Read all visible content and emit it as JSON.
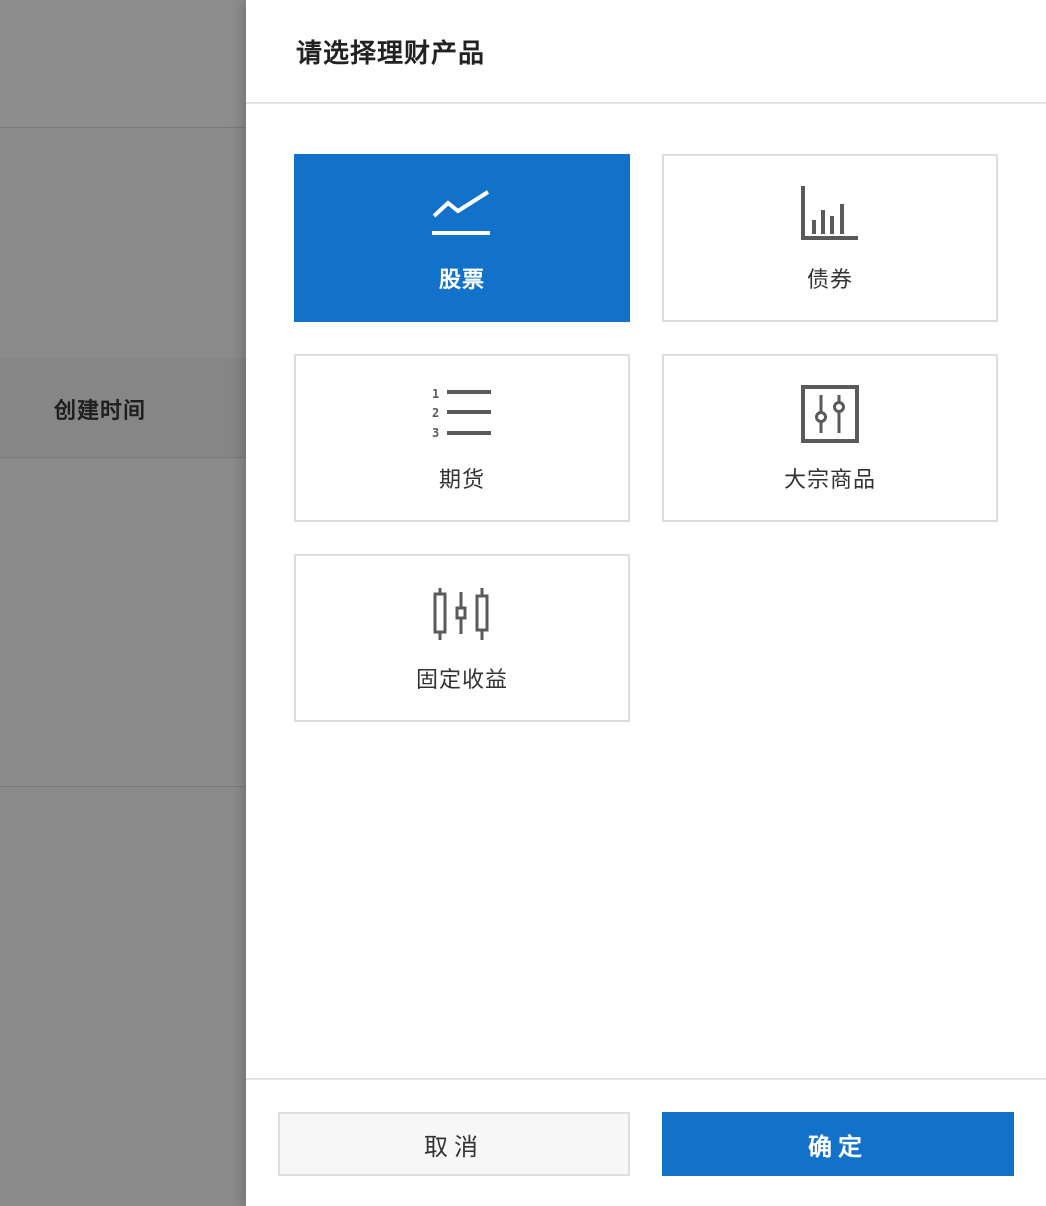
{
  "background": {
    "column_label": "创建时间"
  },
  "drawer": {
    "title": "请选择理财产品",
    "accent_color": "#1272c9",
    "options": [
      {
        "label": "股票",
        "icon": "line-chart-icon",
        "selected": true
      },
      {
        "label": "债券",
        "icon": "bar-chart-icon",
        "selected": false
      },
      {
        "label": "期货",
        "icon": "numbered-list-icon",
        "selected": false
      },
      {
        "label": "大宗商品",
        "icon": "sliders-icon",
        "selected": false
      },
      {
        "label": "固定收益",
        "icon": "candlestick-icon",
        "selected": false
      }
    ],
    "footer": {
      "cancel_label": "取消",
      "confirm_label": "确定"
    }
  }
}
